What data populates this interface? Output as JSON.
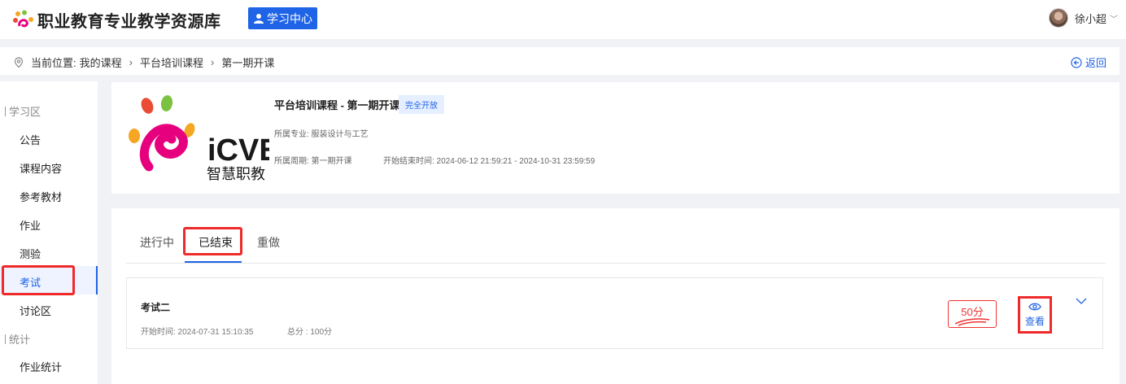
{
  "header": {
    "site_title": "职业教育专业教学资源库",
    "learning_center_label": "学习中心",
    "user_name": "徐小超"
  },
  "breadcrumb": {
    "prefix": "当前位置:",
    "items": [
      "我的课程",
      "平台培训课程",
      "第一期开课"
    ],
    "back_label": "返回"
  },
  "sidebar": {
    "groups": [
      {
        "label": "学习区",
        "items": [
          "公告",
          "课程内容",
          "参考教材",
          "作业",
          "测验",
          "考试",
          "讨论区"
        ]
      },
      {
        "label": "统计",
        "items": [
          "作业统计"
        ]
      }
    ],
    "active_item": "考试"
  },
  "course": {
    "logo_text": "iCVE",
    "logo_subtext": "智慧职教",
    "title": "平台培训课程 - 第一期开课",
    "badge": "完全开放",
    "major": "所属专业: 服装设计与工艺",
    "period": "所属周期: 第一期开课",
    "time": "开始结束时间: 2024-06-12 21:59:21 - 2024-10-31 23:59:59"
  },
  "exam_tabs": [
    "进行中",
    "已结束",
    "重做"
  ],
  "active_tab": "已结束",
  "exams": [
    {
      "name": "考试二",
      "start": "开始时间: 2024-07-31 15:10:35",
      "total": "总分 : 100分",
      "score": "50分",
      "view_label": "查看"
    }
  ],
  "colors": {
    "accent": "#1f63e6",
    "highlight_red": "#ef2a2a"
  }
}
